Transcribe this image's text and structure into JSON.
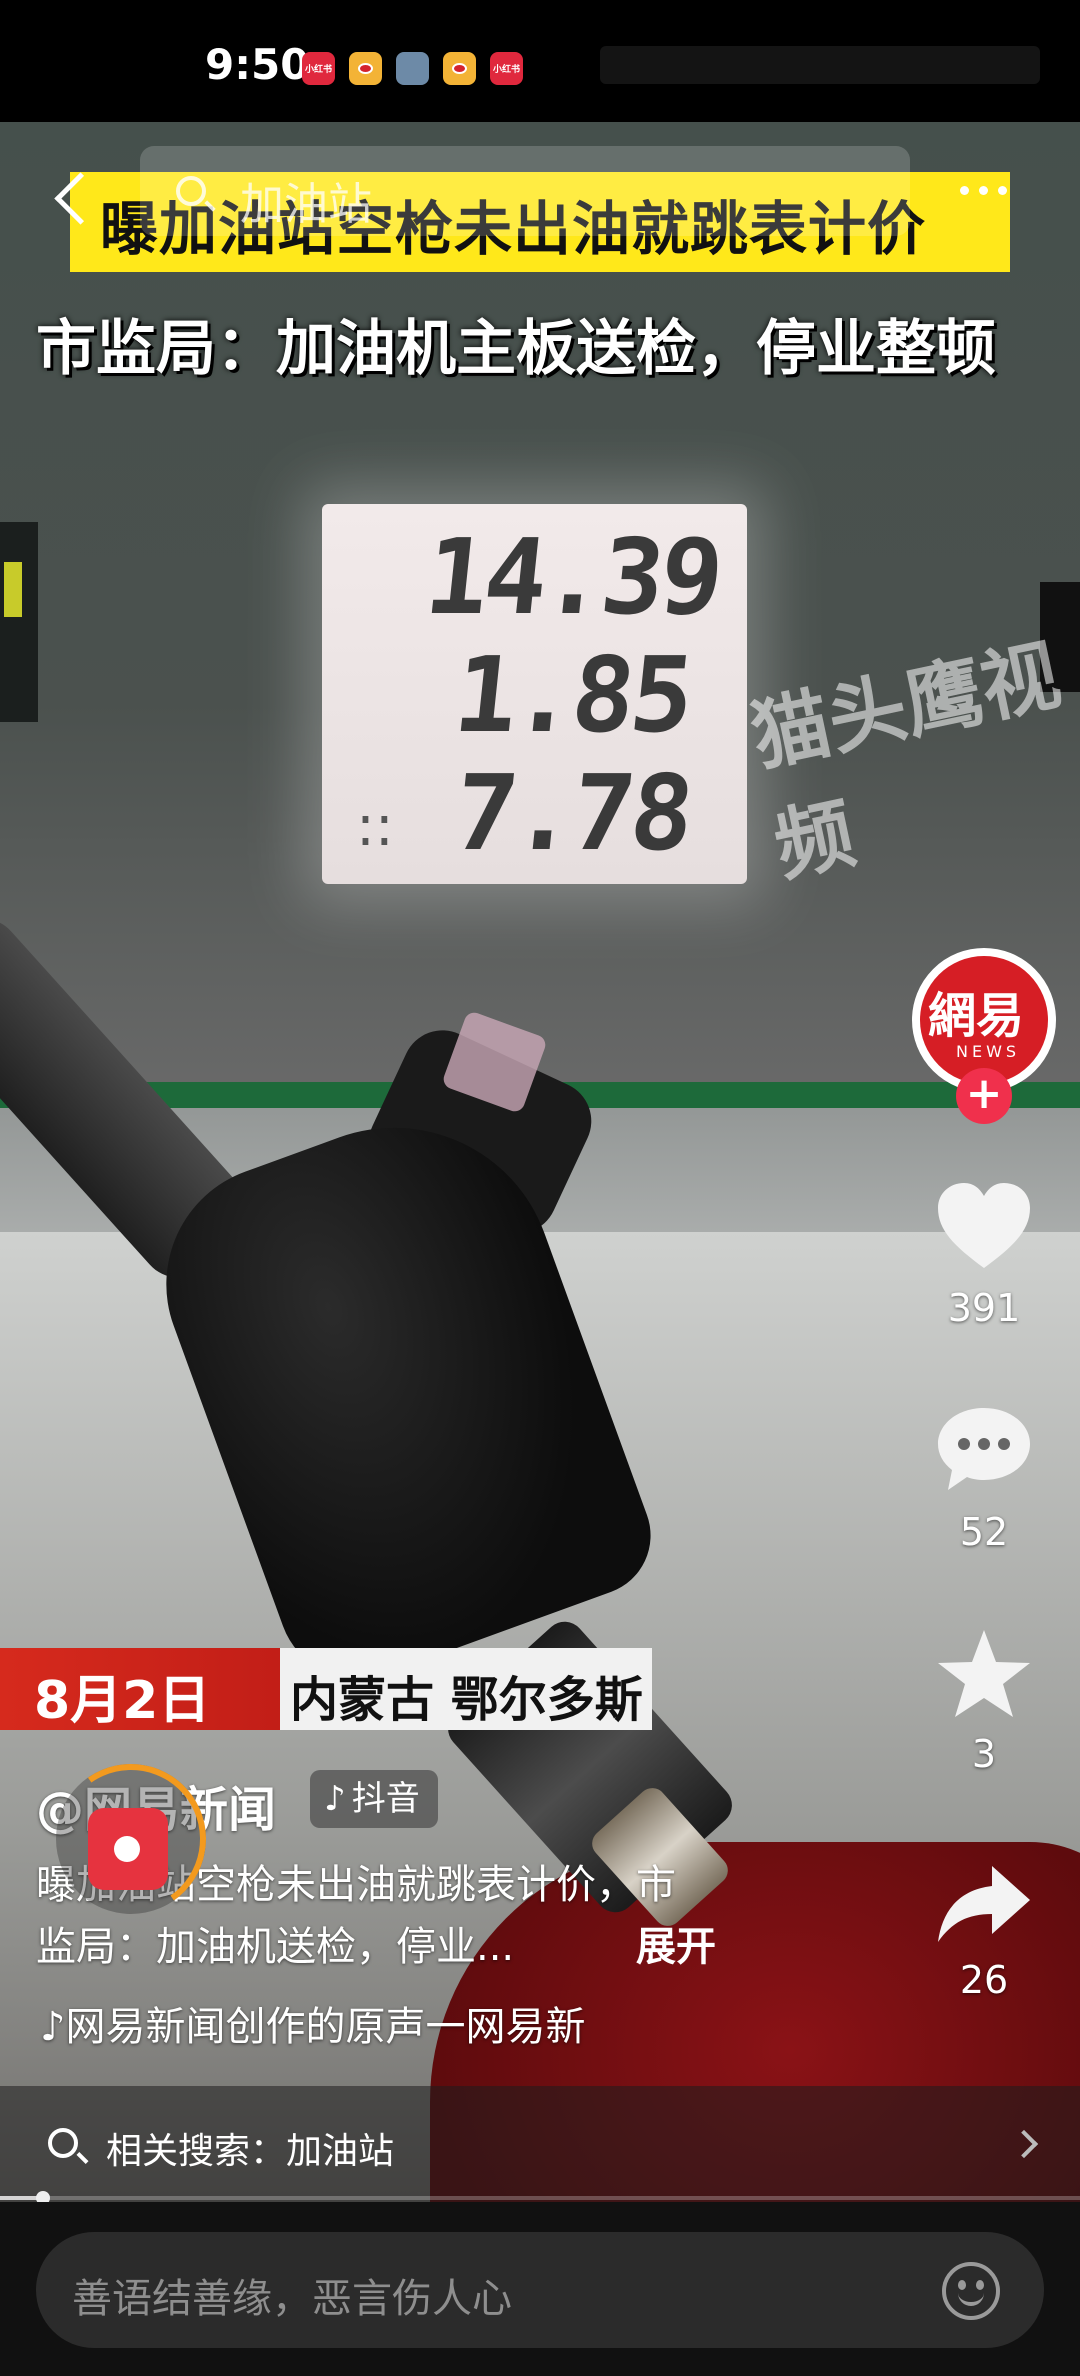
{
  "status_bar": {
    "time": "9:50",
    "icons": [
      {
        "name": "xiaohongshu-icon",
        "label": "小红书"
      },
      {
        "name": "weibo-icon"
      },
      {
        "name": "app-icon"
      },
      {
        "name": "weibo-icon"
      },
      {
        "name": "xiaohongshu-icon",
        "label": "小红书"
      }
    ]
  },
  "top_bar": {
    "search_query": "加油站",
    "back_icon": "chevron-left-icon",
    "more_icon": "more-dots-icon"
  },
  "video": {
    "title_caption": "曝加油站空枪未出油就跳表计价",
    "sub_caption": "市监局：加油机主板送检，停业整顿",
    "pump_readings": [
      "14.39",
      "1.85",
      "7.78"
    ],
    "pump_colon": "::",
    "watermark": "猫头鹰视频",
    "date_caption": "8月2日",
    "location_caption": "内蒙古 鄂尔多斯"
  },
  "actions": {
    "avatar_text": "網易",
    "avatar_sub": "NEWS",
    "follow_label": "+",
    "likes": "391",
    "comments": "52",
    "favorites": "3",
    "shares": "26"
  },
  "post": {
    "author": "@网易新闻",
    "source_badge_icon": "♪",
    "source_badge_label": "抖音",
    "description_line1": "曝加油站空枪未出油就跳表计价，市",
    "description_line2": "监局：加油机送检，停业...",
    "expand_label": "展开",
    "music_icon": "♪",
    "music_text": "网易新闻创作的原声一网易新"
  },
  "related_search": {
    "label": "相关搜索：加油站"
  },
  "progress": {
    "fraction": 0.04
  },
  "comment_bar": {
    "placeholder": "善语结善缘，恶言伤人心"
  },
  "colors": {
    "caption_yellow": "#ffe81a",
    "date_red": "#d62a1d",
    "follow_pink": "#f0304c",
    "avatar_red": "#d61e25"
  }
}
